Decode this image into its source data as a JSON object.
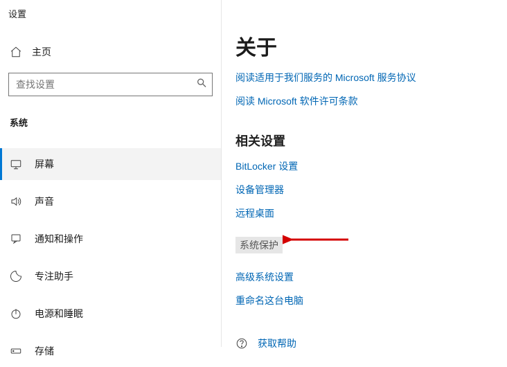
{
  "app": {
    "title": "设置"
  },
  "sidebar": {
    "home": "主页",
    "search_placeholder": "查找设置",
    "category": "系统",
    "items": [
      {
        "label": "屏幕"
      },
      {
        "label": "声音"
      },
      {
        "label": "通知和操作"
      },
      {
        "label": "专注助手"
      },
      {
        "label": "电源和睡眠"
      },
      {
        "label": "存储"
      }
    ]
  },
  "main": {
    "heading": "关于",
    "top_links": [
      "阅读适用于我们服务的 Microsoft 服务协议",
      "阅读 Microsoft 软件许可条款"
    ],
    "related_heading": "相关设置",
    "related_links": {
      "bitlocker": "BitLocker 设置",
      "device_manager": "设备管理器",
      "remote_desktop": "远程桌面",
      "system_protection": "系统保护",
      "advanced": "高级系统设置",
      "rename_pc": "重命名这台电脑"
    },
    "help": "获取帮助"
  }
}
